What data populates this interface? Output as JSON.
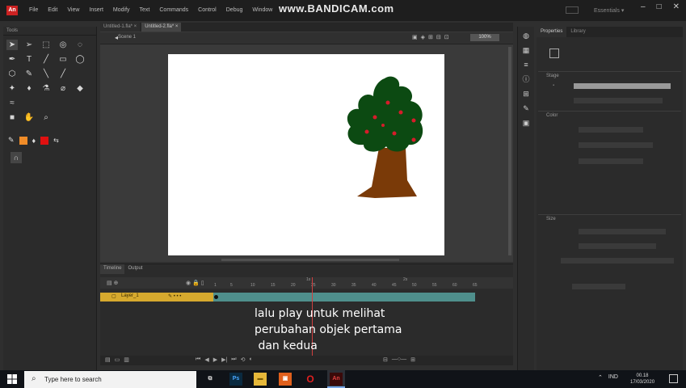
{
  "watermark": "www.BANDICAM.com",
  "menu": [
    "File",
    "Edit",
    "View",
    "Insert",
    "Modify",
    "Text",
    "Commands",
    "Control",
    "Debug",
    "Window"
  ],
  "window": {
    "min": "–",
    "max": "□",
    "close": "✕",
    "workspace": "Essentials ▾"
  },
  "tools_panel": {
    "title": "Tools"
  },
  "documents": {
    "tabs": [
      "Untitled-1.fla* ×",
      "Untitled-2.fla* ×"
    ],
    "scene": "Scene 1",
    "zoom": "100%"
  },
  "timeline": {
    "tabs": [
      "Timeline",
      "Output"
    ],
    "layer_name": "Layer_1",
    "ruler_labels": [
      "1",
      "5",
      "10",
      "15",
      "20",
      "25",
      "30",
      "35",
      "40",
      "45",
      "50",
      "55",
      "60",
      "65"
    ],
    "current_frame_marker": "1s",
    "second_marker": "2s"
  },
  "properties": {
    "tabs": [
      "Properties",
      "Library"
    ],
    "section_labels": [
      "Stage",
      "Color",
      "Size"
    ]
  },
  "subtitle": "lalu play untuk melihat\nperubahan objek pertama\n dan kedua",
  "taskbar": {
    "search_placeholder": "Type here to search",
    "lang": "IND",
    "time": "00.18",
    "date": "17/03/2020"
  },
  "colors": {
    "stroke_swatch": "#f08c28",
    "fill_swatch": "#e01010",
    "layer_highlight": "#d6a92e",
    "frames": "#4f8f8c",
    "foliage": "#0c4a12",
    "apples": "#d61c2a",
    "trunk": "#7a3a08"
  }
}
